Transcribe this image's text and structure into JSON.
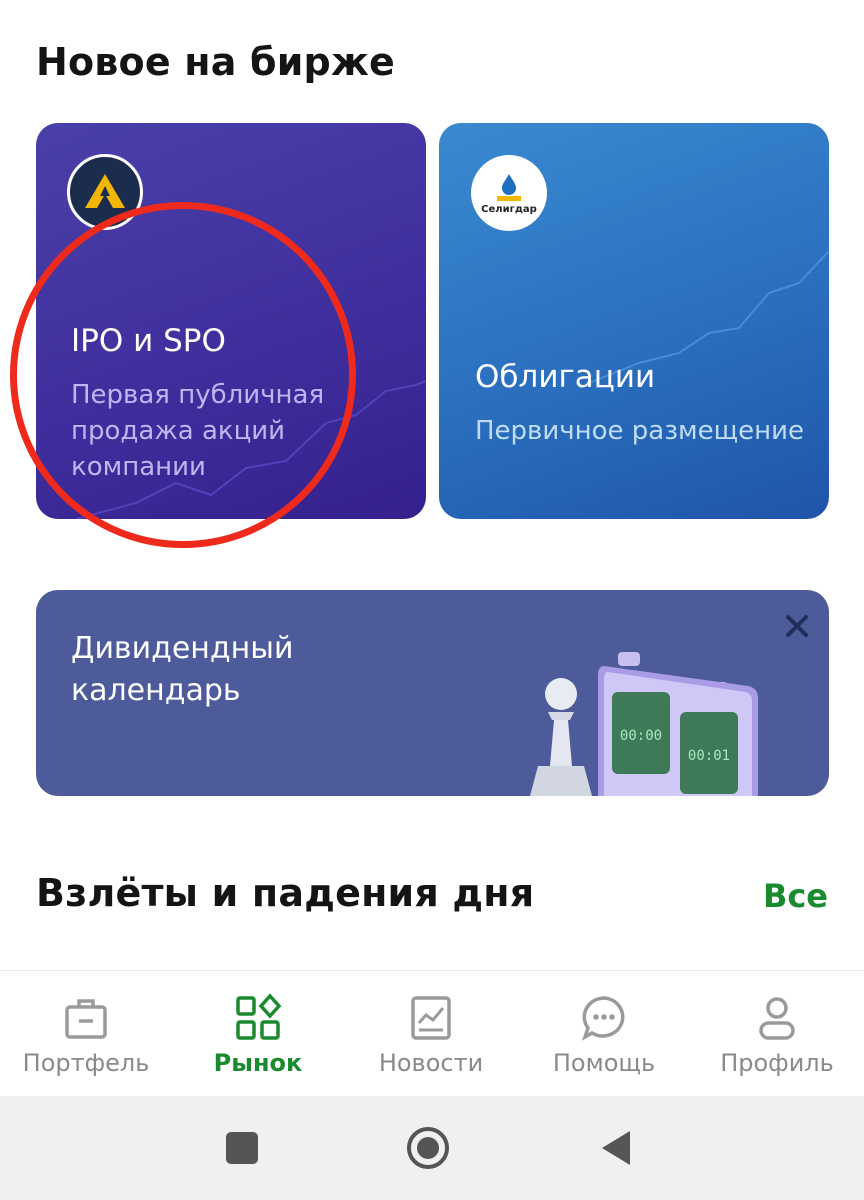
{
  "section_new": {
    "title": "Новое на бирже"
  },
  "cards": {
    "ipo": {
      "title": "IPO и SPO",
      "subtitle": "Первая публичная продажа акций компании",
      "logo_icon": "company-logo-icon"
    },
    "bonds": {
      "title": "Облигации",
      "subtitle": "Первичное размещение",
      "logo_text": "Селигдар",
      "logo_icon": "seligdar-logo-icon"
    }
  },
  "dividend_banner": {
    "title": "Дивидендный календарь",
    "clock_left": "00:00",
    "clock_right": "00:01",
    "close_icon": "close-icon"
  },
  "section_movers": {
    "title": "Взлёты и падения дня",
    "all_link": "Все"
  },
  "tabbar": {
    "items": [
      {
        "label": "Портфель",
        "icon": "briefcase-icon",
        "active": false
      },
      {
        "label": "Рынок",
        "icon": "market-grid-icon",
        "active": true
      },
      {
        "label": "Новости",
        "icon": "news-chart-icon",
        "active": false
      },
      {
        "label": "Помощь",
        "icon": "chat-bubble-icon",
        "active": false
      },
      {
        "label": "Профиль",
        "icon": "person-icon",
        "active": false
      }
    ]
  },
  "system_nav": {
    "recents_icon": "square-recents-icon",
    "home_icon": "circle-home-icon",
    "back_icon": "triangle-back-icon"
  },
  "colors": {
    "accent_green": "#1a8a2e",
    "annotation_red": "#ee2a1c",
    "ipo_card": "#3f2f9e",
    "bonds_card": "#2a6fbe",
    "dividend_card": "#4d5b9a"
  }
}
